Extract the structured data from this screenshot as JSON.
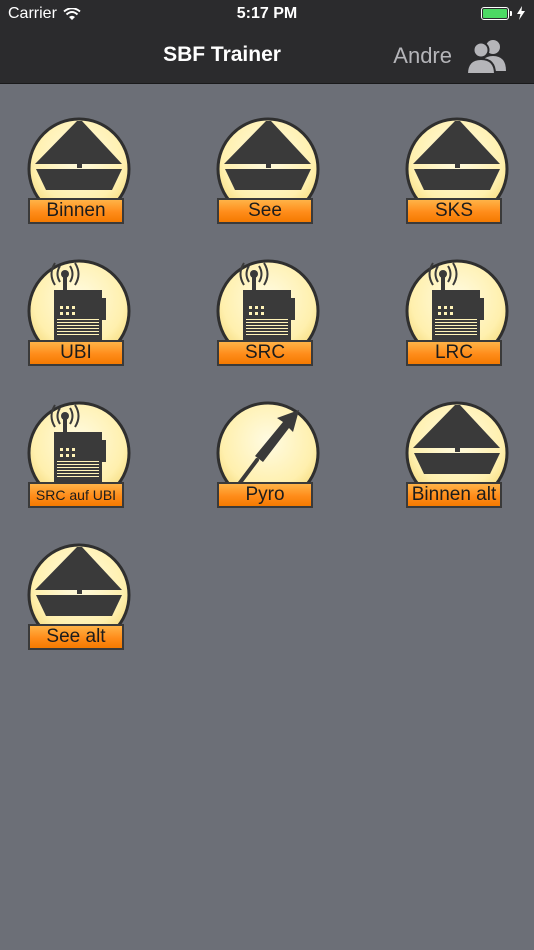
{
  "status_bar": {
    "carrier": "Carrier",
    "time": "5:17 PM"
  },
  "nav": {
    "title": "SBF Trainer",
    "user_name": "Andre"
  },
  "colors": {
    "background": "#6c6f77",
    "bar": "#2b2b2d",
    "label_orange": "#ff8c1a",
    "emblem_fill": "#fff3b8",
    "icon_dark": "#3a3a3a"
  },
  "tiles": [
    {
      "label": "Binnen",
      "icon": "sailboat-icon"
    },
    {
      "label": "See",
      "icon": "sailboat-icon"
    },
    {
      "label": "SKS",
      "icon": "sailboat-icon"
    },
    {
      "label": "UBI",
      "icon": "radio-icon"
    },
    {
      "label": "SRC",
      "icon": "radio-icon"
    },
    {
      "label": "LRC",
      "icon": "radio-icon"
    },
    {
      "label": "SRC auf UBI",
      "icon": "radio-icon"
    },
    {
      "label": "Pyro",
      "icon": "flare-rocket-icon"
    },
    {
      "label": "Binnen alt",
      "icon": "sailboat-icon"
    },
    {
      "label": "See alt",
      "icon": "sailboat-icon"
    }
  ]
}
